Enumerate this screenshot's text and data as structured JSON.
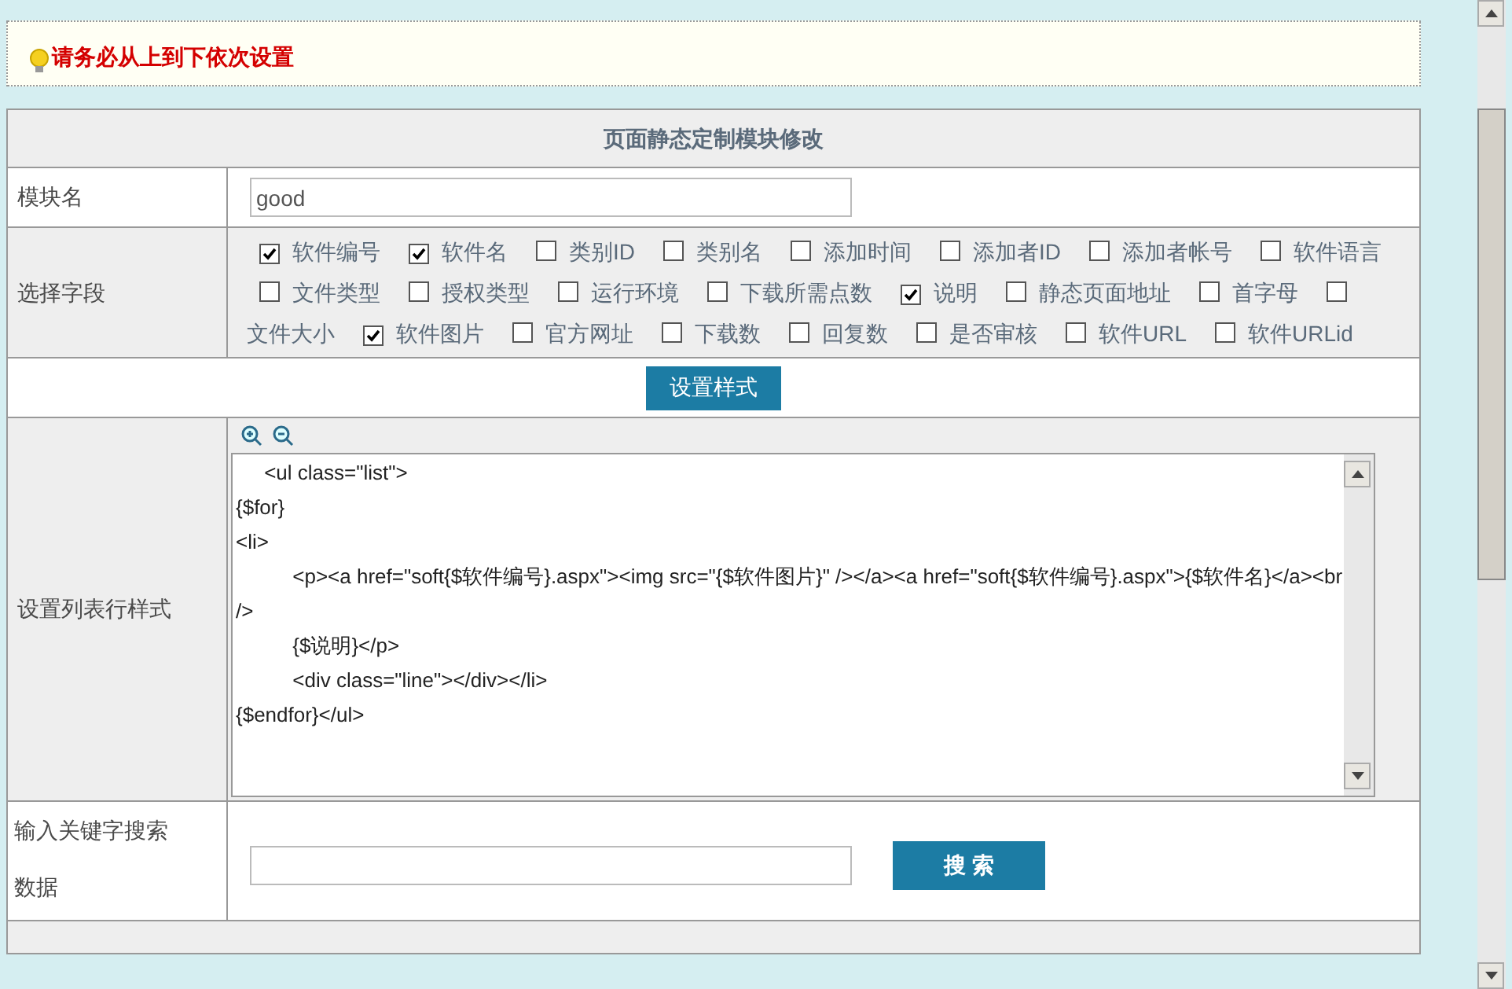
{
  "notice": {
    "text": "请务必从上到下依次设置"
  },
  "table": {
    "title": "页面静态定制模块修改",
    "module_name": {
      "label": "模块名",
      "value": "good"
    },
    "fields": {
      "label": "选择字段",
      "options": [
        {
          "label": "软件编号",
          "checked": true
        },
        {
          "label": "软件名",
          "checked": true
        },
        {
          "label": "类别ID",
          "checked": false
        },
        {
          "label": "类别名",
          "checked": false
        },
        {
          "label": "添加时间",
          "checked": false
        },
        {
          "label": "添加者ID",
          "checked": false
        },
        {
          "label": "添加者帐号",
          "checked": false
        },
        {
          "label": "软件语言",
          "checked": false
        },
        {
          "label": "文件类型",
          "checked": false
        },
        {
          "label": "授权类型",
          "checked": false
        },
        {
          "label": "运行环境",
          "checked": false
        },
        {
          "label": "下载所需点数",
          "checked": false
        },
        {
          "label": "说明",
          "checked": true
        },
        {
          "label": "静态页面地址",
          "checked": false
        },
        {
          "label": "首字母",
          "checked": false
        },
        {
          "label": "文件大小",
          "checked": false
        },
        {
          "label": "软件图片",
          "checked": true
        },
        {
          "label": "官方网址",
          "checked": false
        },
        {
          "label": "下载数",
          "checked": false
        },
        {
          "label": "回复数",
          "checked": false
        },
        {
          "label": "是否审核",
          "checked": false
        },
        {
          "label": "软件URL",
          "checked": false
        },
        {
          "label": "软件URLid",
          "checked": false
        }
      ]
    },
    "style_button": "设置样式",
    "row_style": {
      "label": "设置列表行样式",
      "code": "\t<ul class=\"list\">\n{$for}\n<li>\n\t\t<p><a href=\"soft{$软件编号}.aspx\"><img src=\"{$软件图片}\" /></a><a href=\"soft{$软件编号}.aspx\">{$软件名}</a><br />\n\t\t{$说明}</p>\n\t\t<div class=\"line\"></div></li>\n{$endfor}</ul>"
    },
    "search": {
      "label": "输入关键字搜索数据",
      "button": "搜 索"
    }
  }
}
